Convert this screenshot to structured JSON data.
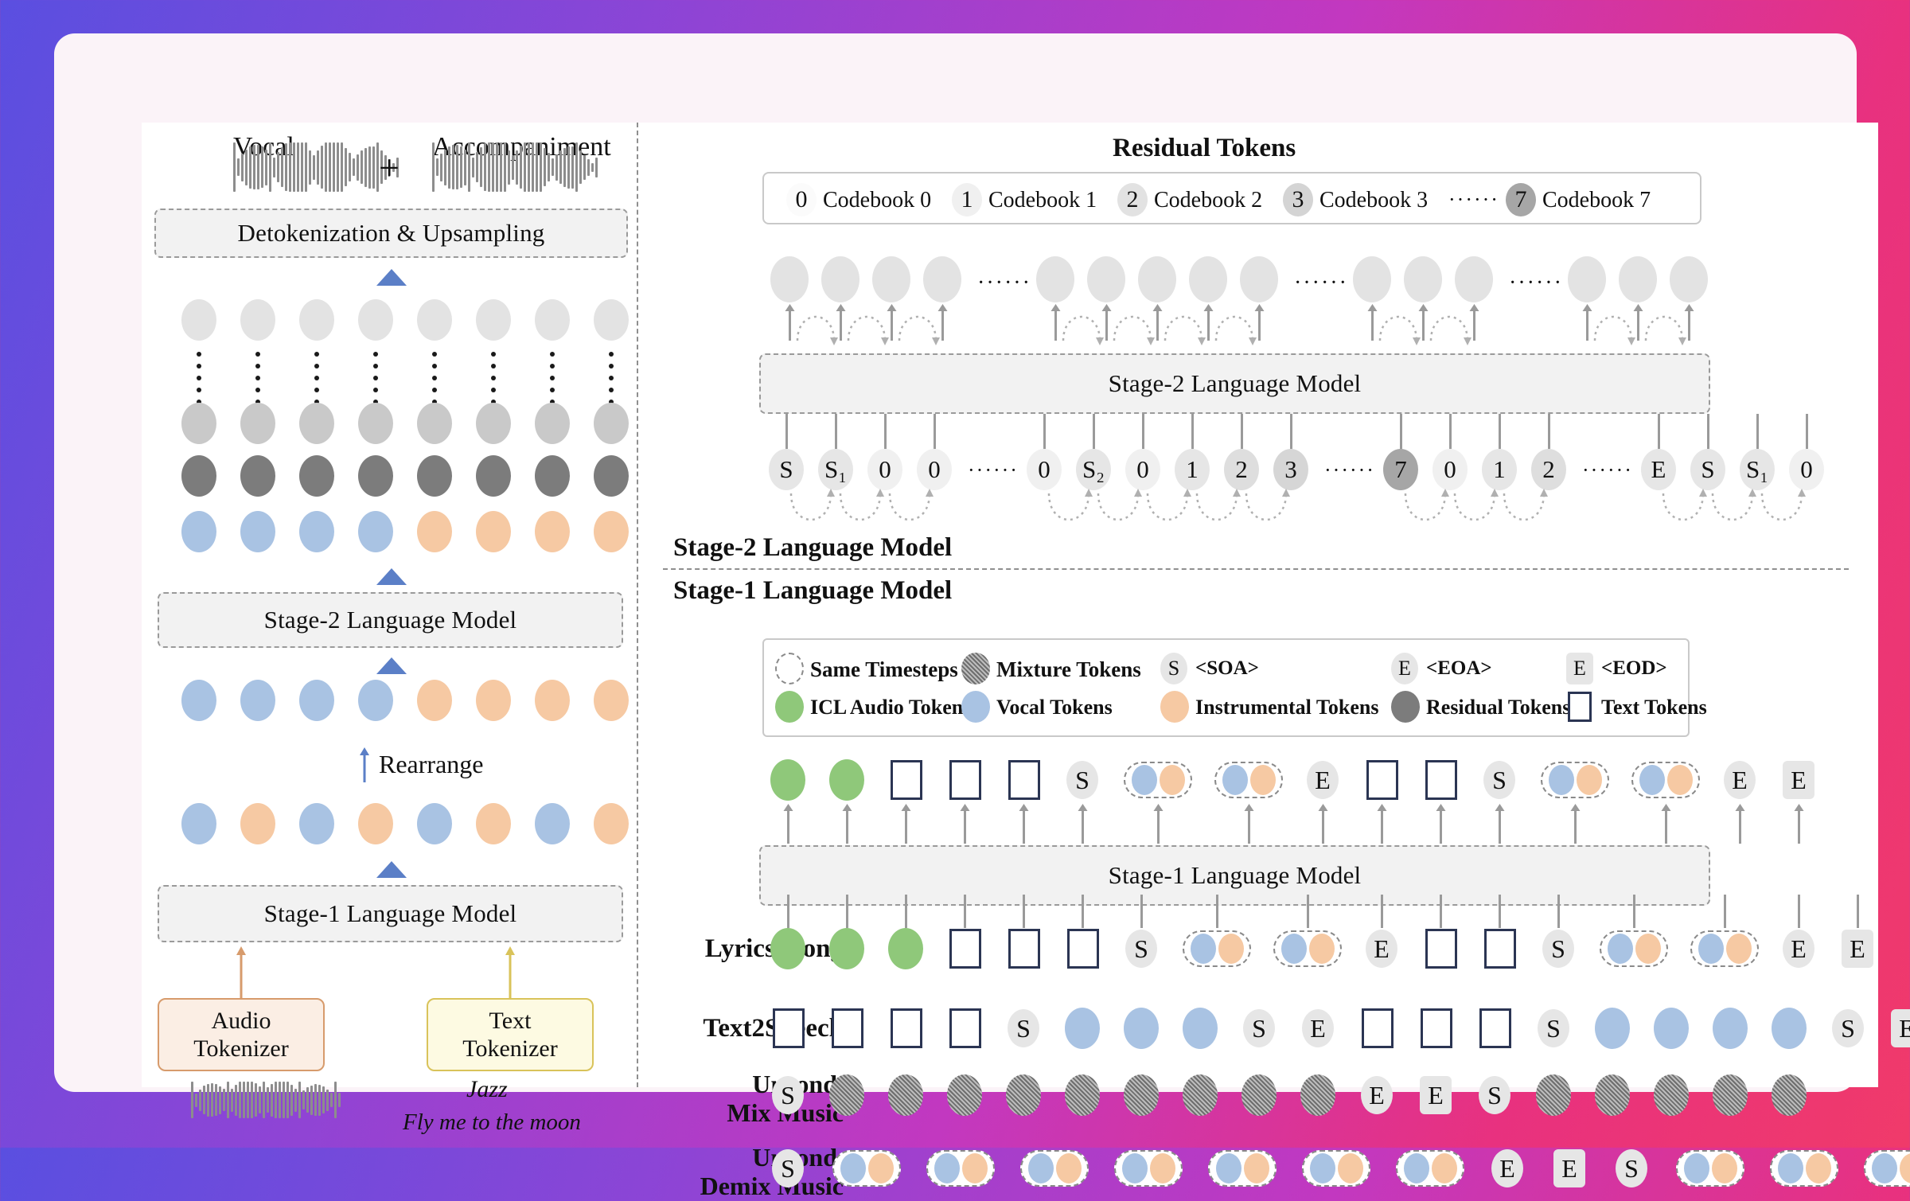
{
  "figure": {
    "left_panel": {
      "vocal_label": "Vocal",
      "accompaniment_label": "Accompaniment",
      "plus": "+",
      "detokenization_box": "Detokenization & Upsampling",
      "stage2_box": "Stage-2 Language Model",
      "stage1_box": "Stage-1 Language Model",
      "rearrange_label": "Rearrange",
      "audio_tokenizer": "Audio\nTokenizer",
      "audio_tokenizer_line1": "Audio",
      "audio_tokenizer_line2": "Tokenizer",
      "text_tokenizer_line1": "Text",
      "text_tokenizer_line2": "Tokenizer",
      "text_prompt_genre": "Jazz",
      "text_prompt_lyrics": "Fly me to the moon",
      "rows": {
        "row_light": [
          "light",
          "light",
          "light",
          "light",
          "light",
          "light",
          "light",
          "light"
        ],
        "row_mid": [
          "mid",
          "mid",
          "mid",
          "mid",
          "mid",
          "mid",
          "mid",
          "mid"
        ],
        "row_dark": [
          "dark",
          "dark",
          "dark",
          "dark",
          "dark",
          "dark",
          "dark",
          "dark"
        ],
        "row_mix_sorted": [
          "vocal",
          "vocal",
          "vocal",
          "vocal",
          "instr",
          "instr",
          "instr",
          "instr"
        ],
        "row_after_s2": [
          "vocal",
          "vocal",
          "vocal",
          "vocal",
          "instr",
          "instr",
          "instr",
          "instr"
        ],
        "row_interleaved": [
          "vocal",
          "instr",
          "vocal",
          "instr",
          "vocal",
          "instr",
          "vocal",
          "instr"
        ]
      }
    },
    "right_panel": {
      "residual_title": "Residual Tokens",
      "codebooks": [
        {
          "id": "0",
          "label": "Codebook 0"
        },
        {
          "id": "1",
          "label": "Codebook 1"
        },
        {
          "id": "2",
          "label": "Codebook 2"
        },
        {
          "id": "3",
          "label": "Codebook 3"
        },
        {
          "ellipsis": "······"
        },
        {
          "id": "7",
          "label": "Codebook 7"
        }
      ],
      "stage2_model_box": "Stage-2 Language Model",
      "stage1_model_box": "Stage-1 Language Model",
      "divider_stage2_label": "Stage-2 Language Model",
      "divider_stage1_label": "Stage-1 Language Model",
      "stage2_input_sequence": [
        "S",
        "S₁",
        "0",
        "0",
        "⋯",
        "0",
        "S₂",
        "0",
        "1",
        "2",
        "3",
        "⋯",
        "7",
        "0",
        "1",
        "2",
        "⋯",
        "E",
        "S",
        "S₁",
        "0"
      ],
      "legend": {
        "row1": [
          {
            "glyph": "same-timesteps",
            "text": "Same Timesteps"
          },
          {
            "glyph": "mixture",
            "text": "Mixture Tokens"
          },
          {
            "glyph": "S-round",
            "text": "<SOA>"
          },
          {
            "glyph": "E-round",
            "text": "<EOA>"
          },
          {
            "glyph": "E-square",
            "text": "<EOD>"
          }
        ],
        "row2": [
          {
            "glyph": "icl",
            "text": "ICL Audio Tokens"
          },
          {
            "glyph": "vocal",
            "text": "Vocal Tokens"
          },
          {
            "glyph": "instr",
            "text": "Instrumental Tokens"
          },
          {
            "glyph": "residual",
            "text": "Residual Tokens"
          },
          {
            "glyph": "text",
            "text": "Text Tokens"
          }
        ]
      },
      "stage1_output_sequence": [
        "icl",
        "icl",
        "text",
        "text",
        "text",
        "S",
        "pair",
        "pair",
        "E",
        "text",
        "text",
        "S",
        "pair",
        "pair",
        "E",
        "Esq"
      ],
      "task_rows": [
        {
          "name": "Lyrics2Song",
          "label": "Lyrics2Song",
          "sequence": [
            "icl",
            "icl",
            "icl",
            "text",
            "text",
            "text",
            "S",
            "pair",
            "pair",
            "E",
            "text",
            "text",
            "S",
            "pair",
            "pair",
            "E",
            "Esq"
          ]
        },
        {
          "name": "Text2Speech",
          "label": "Text2Speech",
          "sequence": [
            "text",
            "text",
            "text",
            "text",
            "S",
            "vocal",
            "vocal",
            "vocal",
            "S",
            "E",
            "text",
            "text",
            "text",
            "S",
            "vocal",
            "vocal",
            "vocal",
            "vocal",
            "S",
            "Esq"
          ]
        },
        {
          "name": "Uncond. Mix Music",
          "label_line1": "Uncond.",
          "label_line2": "Mix Music",
          "sequence": [
            "S",
            "mix",
            "mix",
            "mix",
            "mix",
            "mix",
            "mix",
            "mix",
            "mix",
            "mix",
            "E",
            "Esq",
            "S",
            "mix",
            "mix",
            "mix",
            "mix",
            "mix"
          ]
        },
        {
          "name": "Uncond. Demix Music",
          "label_line1": "Uncond.",
          "label_line2": "Demix Music",
          "sequence": [
            "S",
            "pair",
            "pair",
            "pair",
            "pair",
            "pair",
            "pair",
            "pair",
            "E",
            "Esq",
            "S",
            "pair",
            "pair",
            "pair"
          ]
        }
      ]
    },
    "colors": {
      "vocal": "#a9c3e3",
      "instrumental": "#f6c9a3",
      "icl_audio": "#8fc87a",
      "residual_dark": "#7c7c7c",
      "light_gray": "#e3e3e3",
      "mid_gray": "#c9c9c9",
      "text_token_border": "#2b3553",
      "badge_bg": "#e6e6e6",
      "accent_arrow": "#5b7fc7",
      "audio_tokenizer_fill": "#fbeee4",
      "audio_tokenizer_border": "#d79b6c",
      "text_tokenizer_fill": "#fdfae2",
      "text_tokenizer_border": "#d9c35a"
    }
  }
}
